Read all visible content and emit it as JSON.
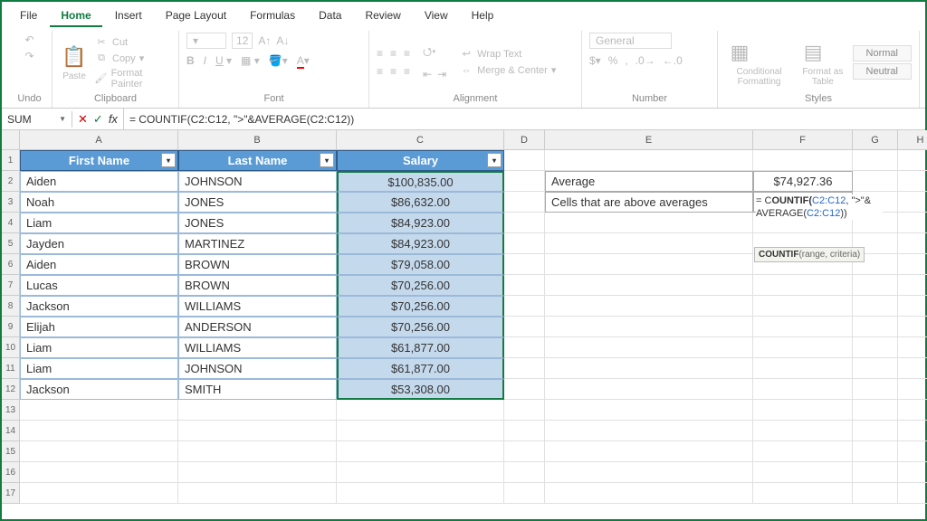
{
  "menu": [
    "File",
    "Home",
    "Insert",
    "Page Layout",
    "Formulas",
    "Data",
    "Review",
    "View",
    "Help"
  ],
  "menu_active": 1,
  "ribbon": {
    "undo": "Undo",
    "clipboard": {
      "label": "Clipboard",
      "paste": "Paste",
      "cut": "Cut",
      "copy": "Copy",
      "fp": "Format Painter"
    },
    "font": {
      "label": "Font",
      "size": "12"
    },
    "alignment": {
      "label": "Alignment",
      "wrap": "Wrap Text",
      "merge": "Merge & Center"
    },
    "number": {
      "label": "Number",
      "format": "General"
    },
    "styles": {
      "label": "Styles",
      "cf": "Conditional Formatting",
      "fat": "Format as Table",
      "normal": "Normal",
      "neutral": "Neutral"
    }
  },
  "formula_bar": {
    "name": "SUM",
    "fx": "fx",
    "formula": "= COUNTIF(C2:C12, \">\"&AVERAGE(C2:C12))"
  },
  "columns": [
    "A",
    "B",
    "C",
    "D",
    "E",
    "F",
    "G",
    "H"
  ],
  "headers": [
    "First Name",
    "Last Name",
    "Salary"
  ],
  "table": [
    [
      "Aiden",
      "JOHNSON",
      "$100,835.00"
    ],
    [
      "Noah",
      "JONES",
      "$86,632.00"
    ],
    [
      "Liam",
      "JONES",
      "$84,923.00"
    ],
    [
      "Jayden",
      "MARTINEZ",
      "$84,923.00"
    ],
    [
      "Aiden",
      "BROWN",
      "$79,058.00"
    ],
    [
      "Lucas",
      "BROWN",
      "$70,256.00"
    ],
    [
      "Jackson",
      "WILLIAMS",
      "$70,256.00"
    ],
    [
      "Elijah",
      "ANDERSON",
      "$70,256.00"
    ],
    [
      "Liam",
      "WILLIAMS",
      "$61,877.00"
    ],
    [
      "Liam",
      "JOHNSON",
      "$61,877.00"
    ],
    [
      "Jackson",
      "SMITH",
      "$53,308.00"
    ]
  ],
  "side": {
    "avg_label": "Average",
    "avg_val": "$74,927.36",
    "above_label": "Cells that are above averages",
    "editing": {
      "p1": "= C",
      "p2": "OUNTIF(",
      "r1": "C2:C12",
      "p3": ", \">\"& AVERAGE(",
      "r2": "C2:C12",
      "p4": "))"
    },
    "tooltip": {
      "fn": "COUNTIF",
      "sig": "(range, criteria)"
    }
  },
  "chart_data": {
    "type": "table",
    "title": "Salary table with COUNTIF above-average formula",
    "columns": [
      "First Name",
      "Last Name",
      "Salary"
    ],
    "rows": [
      [
        "Aiden",
        "JOHNSON",
        100835.0
      ],
      [
        "Noah",
        "JONES",
        86632.0
      ],
      [
        "Liam",
        "JONES",
        84923.0
      ],
      [
        "Jayden",
        "MARTINEZ",
        84923.0
      ],
      [
        "Aiden",
        "BROWN",
        79058.0
      ],
      [
        "Lucas",
        "BROWN",
        70256.0
      ],
      [
        "Jackson",
        "WILLIAMS",
        70256.0
      ],
      [
        "Elijah",
        "ANDERSON",
        70256.0
      ],
      [
        "Liam",
        "WILLIAMS",
        61877.0
      ],
      [
        "Liam",
        "JOHNSON",
        61877.0
      ],
      [
        "Jackson",
        "SMITH",
        53308.0
      ]
    ],
    "average": 74927.36
  }
}
